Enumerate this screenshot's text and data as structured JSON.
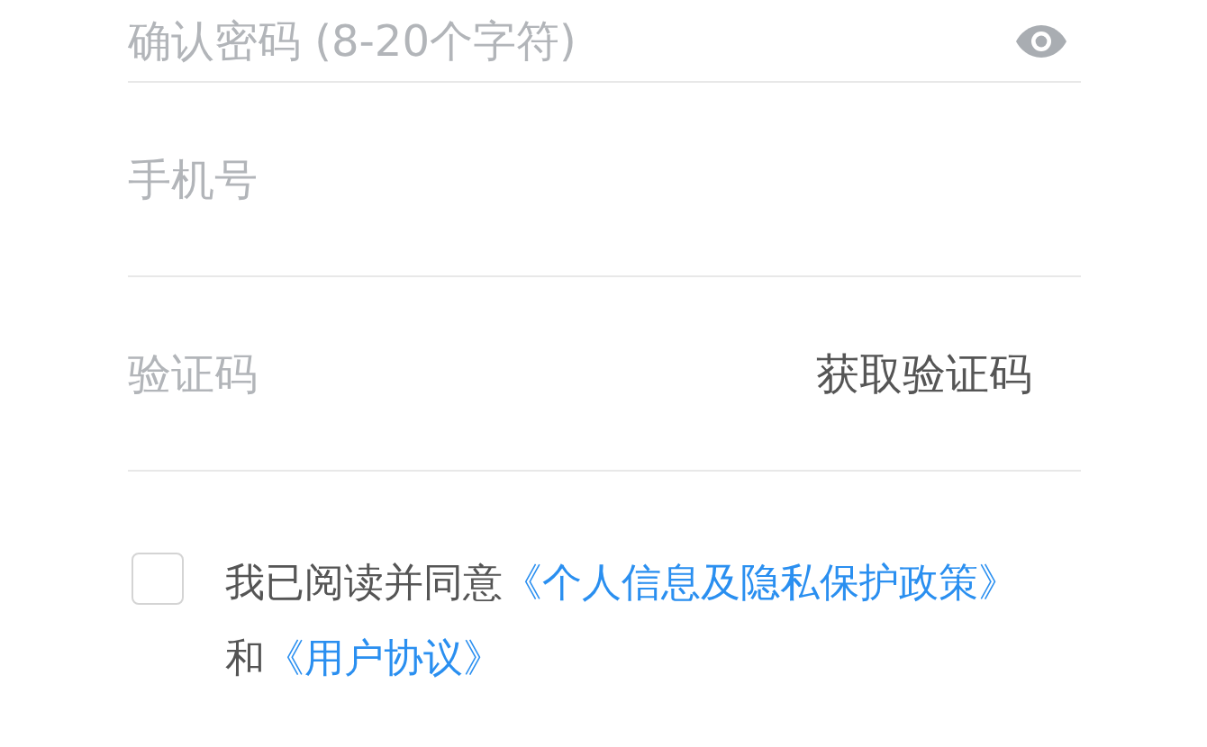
{
  "fields": [
    {
      "kind": "password",
      "placeholder": "确认密码 (8-20个字符)"
    },
    {
      "kind": "phone",
      "placeholder": "手机号"
    },
    {
      "kind": "code",
      "placeholder": "验证码",
      "action": "获取验证码"
    }
  ],
  "agreement": {
    "checked": false,
    "text": "我已阅读并同意",
    "links": [
      "《个人信息及隐私保护政策》",
      "《用户协议》"
    ],
    "joiner": "和"
  }
}
